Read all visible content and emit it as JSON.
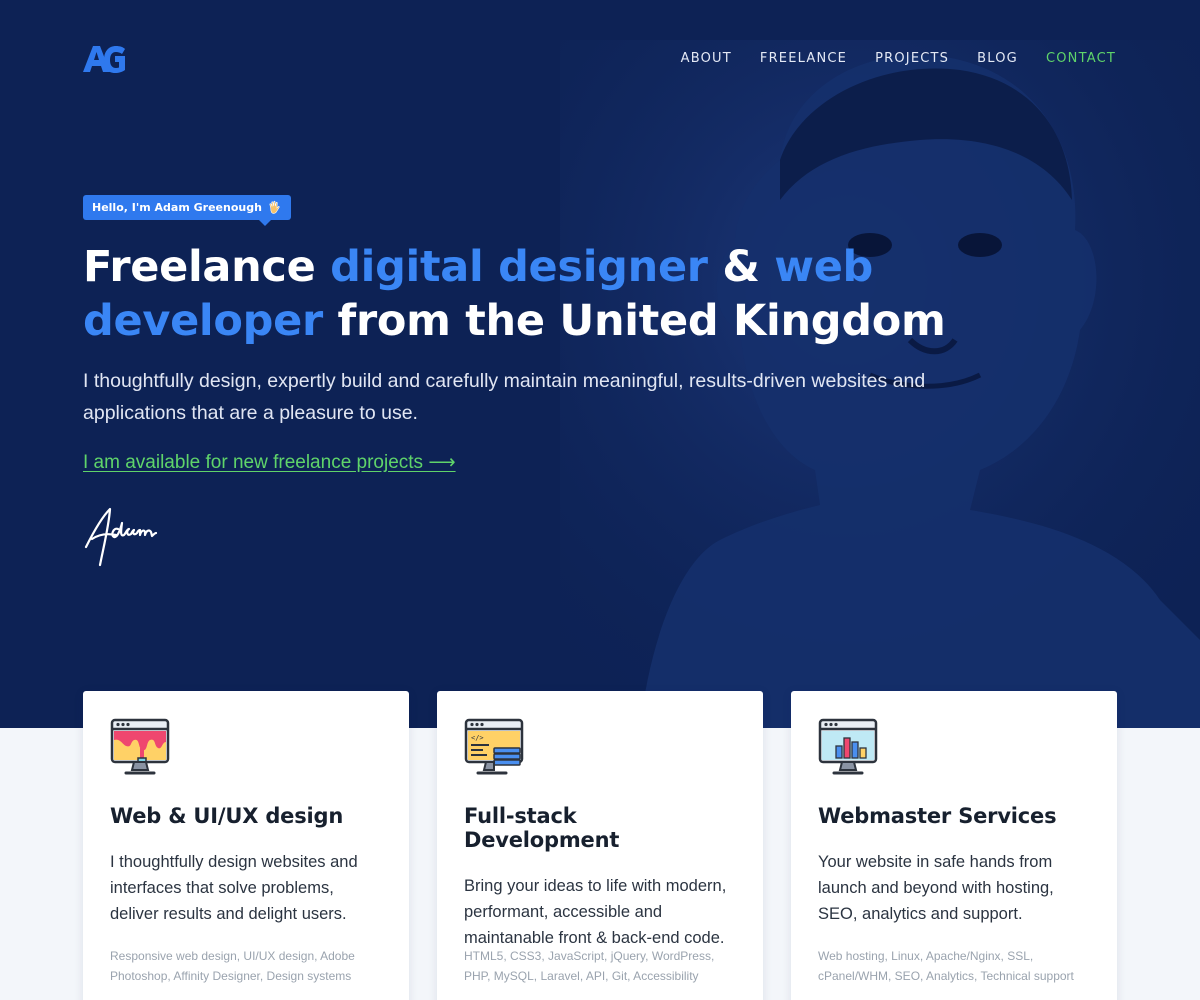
{
  "brand": {
    "logo_text": "AG",
    "accent": "#3a86f5",
    "hero_bg": "#0d2255",
    "link_green": "#5fd46a"
  },
  "nav": [
    {
      "label": "ABOUT"
    },
    {
      "label": "FREELANCE"
    },
    {
      "label": "PROJECTS"
    },
    {
      "label": "BLOG"
    },
    {
      "label": "CONTACT"
    }
  ],
  "hero": {
    "badge": "Hello, I'm Adam Greenough",
    "badge_icon": "waving-hand-icon",
    "headline": {
      "p1": "Freelance ",
      "p2": "digital designer",
      "p3": " & ",
      "p4": "web developer",
      "p5": " from the United Kingdom"
    },
    "intro": "I thoughtfully design, expertly build and carefully maintain meaningful, results-driven websites and applications that are a pleasure to use.",
    "cta": "I am available for new freelance projects ⟶",
    "signature": "Adam"
  },
  "cards": [
    {
      "icon": "design-monitor-icon",
      "title": "Web & UI/UX design",
      "text": "I thoughtfully design websites and interfaces that solve problems, deliver results and delight users.",
      "tags": "Responsive web design, UI/UX design, Adobe Photoshop, Affinity Designer, Design systems"
    },
    {
      "icon": "code-monitor-icon",
      "title": "Full-stack Development",
      "text": "Bring your ideas to life with modern, performant, accessible and maintanable front & back-end code.",
      "tags": "HTML5, CSS3, JavaScript, jQuery, WordPress, PHP, MySQL, Laravel, API, Git, Accessibility"
    },
    {
      "icon": "analytics-monitor-icon",
      "title": "Webmaster Services",
      "text": "Your website in safe hands from launch and beyond with hosting, SEO, analytics and support.",
      "tags": "Web hosting, Linux, Apache/Nginx, SSL, cPanel/WHM, SEO, Analytics, Technical support"
    }
  ]
}
